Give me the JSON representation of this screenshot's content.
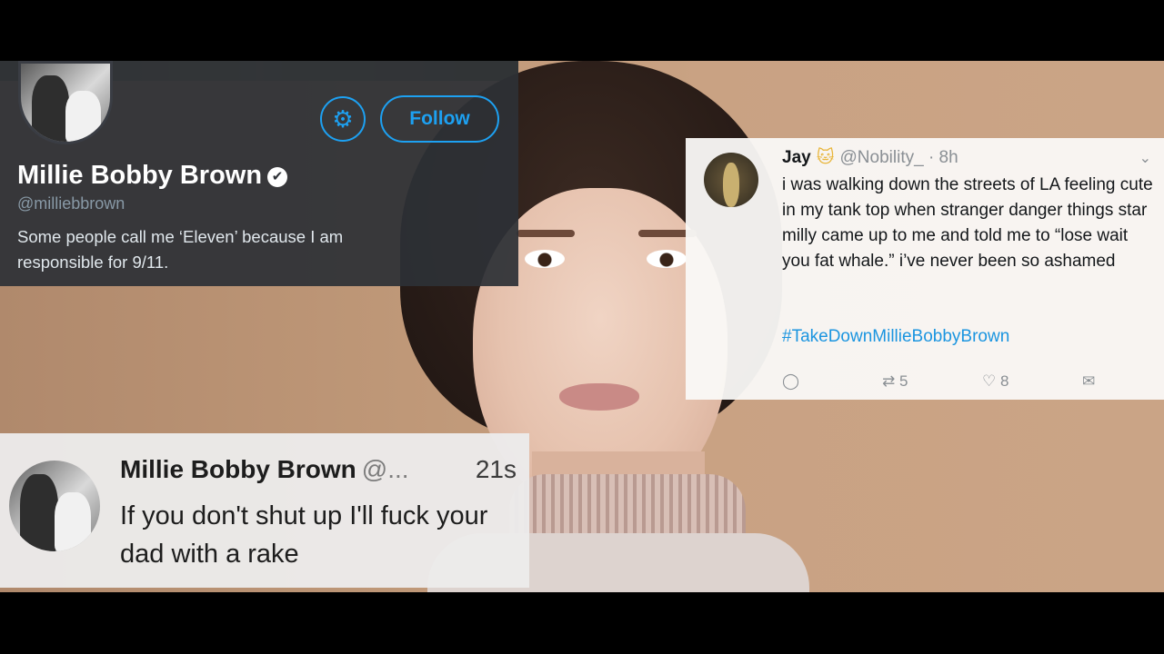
{
  "profile_card": {
    "follow_label": "Follow",
    "name": "Millie Bobby Brown",
    "verified_glyph": "✔",
    "handle": "@milliebbrown",
    "bio": "Some people call me ‘Eleven’ because I am responsible for 9/11.",
    "icons": [
      "gear-icon",
      "verified-badge-icon"
    ]
  },
  "jay_tweet": {
    "name": "Jay",
    "name_emoji": "🐱",
    "handle_time": "@Nobility_ · 8h",
    "chevron": "⌄",
    "body": "i was walking down the streets of LA feeling cute in my tank top when stranger danger things star milly came up to me and told me to “lose wait you fat whale.” i’ve never been so ashamed",
    "hashtag": "#TakeDownMillieBobbyBrown",
    "actions": {
      "reply_icon": "◯",
      "retweet_icon": "⇄",
      "retweet_count": "5",
      "like_icon": "♡",
      "like_count": "8",
      "dm_icon": "✉"
    }
  },
  "millie_tweet": {
    "name": "Millie Bobby Brown",
    "handle": "@...",
    "time": "21s",
    "body": "If you don't shut up I'll fuck your dad with a rake"
  },
  "colors": {
    "accent": "#1da1f2",
    "hashtag": "#1b95e0",
    "dark_card": "#2d3036",
    "light_card": "#faf9f7"
  }
}
